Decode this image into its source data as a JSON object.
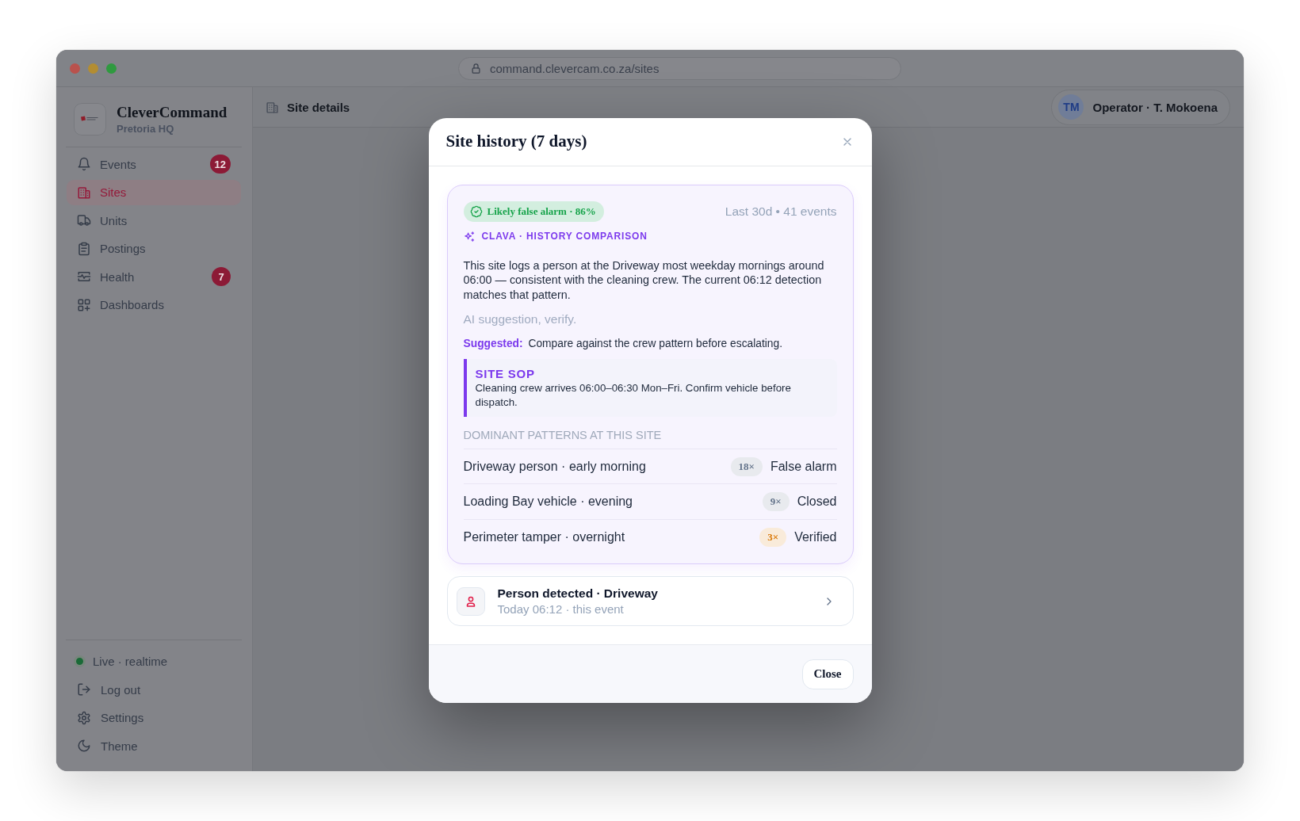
{
  "browser": {
    "url": "command.clevercam.co.za/sites"
  },
  "sidebar": {
    "brand": {
      "name": "CleverCommand",
      "subtitle": "Pretoria HQ"
    },
    "nav": [
      {
        "label": "Events",
        "badge": "12",
        "selected": false
      },
      {
        "label": "Sites",
        "selected": true
      },
      {
        "label": "Units",
        "selected": false
      },
      {
        "label": "Postings",
        "selected": false
      },
      {
        "label": "Health",
        "badge": "7",
        "selected": false
      },
      {
        "label": "Dashboards",
        "selected": false
      }
    ],
    "status": {
      "label": "Live · realtime",
      "connected": true
    },
    "actions": [
      {
        "label": "Log out"
      },
      {
        "label": "Settings"
      },
      {
        "label": "Theme"
      }
    ]
  },
  "topbar": {
    "title": "Site details",
    "user": {
      "initials": "TM",
      "label": "Operator · T. Mokoena"
    }
  },
  "modal": {
    "title": "Site history (7 days)",
    "card": {
      "verdict": "Likely false alarm · 86%",
      "meta": "Last 30d • 41 events",
      "source": "CLAVA · HISTORY COMPARISON",
      "summary": "This site logs a person at the Driveway most weekday mornings around 06:00 — consistent with the cleaning crew. The current 06:12 detection matches that pattern.",
      "disclaimer": "AI suggestion, verify.",
      "suggestion": "**Suggested:** Compare against the crew pattern before escalating.",
      "sop": {
        "title": "SITE SOP",
        "text": "Cleaning crew arrives 06:00–06:30 Mon–Fri. Confirm vehicle before dispatch."
      },
      "patterns": {
        "heading": "DOMINANT PATTERNS AT THIS SITE",
        "rows": [
          {
            "name": "Driveway person · early morning",
            "count": "18×",
            "outcome": "False alarm",
            "color": "#64748b"
          },
          {
            "name": "Loading Bay vehicle · evening",
            "count": "9×",
            "outcome": "Closed",
            "color": "#64748b"
          },
          {
            "name": "Perimeter tamper · overnight",
            "count": "3×",
            "outcome": "Verified",
            "color": "#d97706"
          }
        ]
      }
    },
    "event": {
      "title": "Person detected · Driveway",
      "subtitle": "Today 06:12 · this event"
    },
    "buttons": [
      "Close"
    ]
  }
}
